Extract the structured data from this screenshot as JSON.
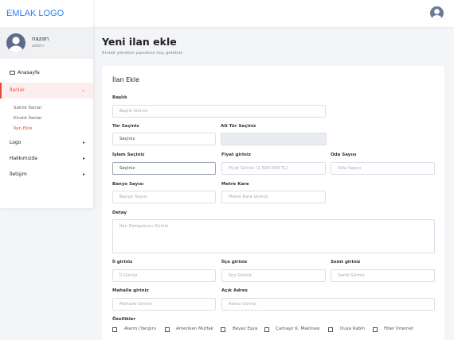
{
  "brand": {
    "logo_text": "EMLAK LOGO"
  },
  "user": {
    "name": "nazan",
    "subtitle": "ozlem"
  },
  "sidebar": {
    "items": [
      {
        "label": "Anasayfa"
      },
      {
        "label": "İlanlar"
      },
      {
        "label": "Logo"
      },
      {
        "label": "Hakkımızda"
      },
      {
        "label": "İletişim"
      }
    ],
    "submenu": [
      {
        "label": "Satılık İlanlar"
      },
      {
        "label": "Kiralık İlanlar"
      },
      {
        "label": "İlan Ekle"
      }
    ]
  },
  "page": {
    "title": "Yeni ilan ekle",
    "subtitle": "Emlak yönetim panaline hoş geldiniz"
  },
  "form": {
    "card_title": "İlan Ekle",
    "baslik": {
      "label": "Başlık",
      "placeholder": "Başlık Giriniz"
    },
    "tur": {
      "label": "Tür Seçiniz",
      "value": "Seçiniz"
    },
    "alt_tur": {
      "label": "Alt Tür Seçiniz",
      "value": ""
    },
    "islem": {
      "label": "İşlem Seçiniz",
      "value": "Seçiniz"
    },
    "fiyat": {
      "label": "Fiyat giriniz",
      "placeholder": "Fiyat Giriniz (1.500.000 TL)"
    },
    "oda": {
      "label": "Oda Sayısı",
      "placeholder": "Oda Sayısı"
    },
    "banyo": {
      "label": "Banyo Sayısı",
      "placeholder": "Banyo Sayısı"
    },
    "metre": {
      "label": "Metre Kare",
      "placeholder": "Metre Kare Giriniz"
    },
    "detay": {
      "label": "Detay",
      "placeholder": "İlan Detaylarını Giriniz"
    },
    "il": {
      "label": "İl giriniz",
      "placeholder": "İl Giriniz"
    },
    "ilce": {
      "label": "İlçe giriniz",
      "placeholder": "İlçe Giriniz"
    },
    "semt": {
      "label": "Semt giriniz",
      "placeholder": "Semt Giriniz"
    },
    "mahalle": {
      "label": "Mahalle giriniz",
      "placeholder": "Mahalle Giriniz"
    },
    "adres": {
      "label": "Açık Adres",
      "placeholder": "Adres Giriniz"
    },
    "ozellikler": {
      "label": "Özellikler",
      "items": [
        {
          "label": "Alarm (Yangın)"
        },
        {
          "label": "Amerikan Mutfak"
        },
        {
          "label": "Beyaz Eşya"
        },
        {
          "label": "Çamaşır K. Makinası"
        },
        {
          "label": "Duşa Kabin"
        },
        {
          "label": "Fiber İnternet"
        }
      ]
    }
  },
  "colors": {
    "accent": "#e8453c",
    "brand": "#2a7ff5"
  }
}
